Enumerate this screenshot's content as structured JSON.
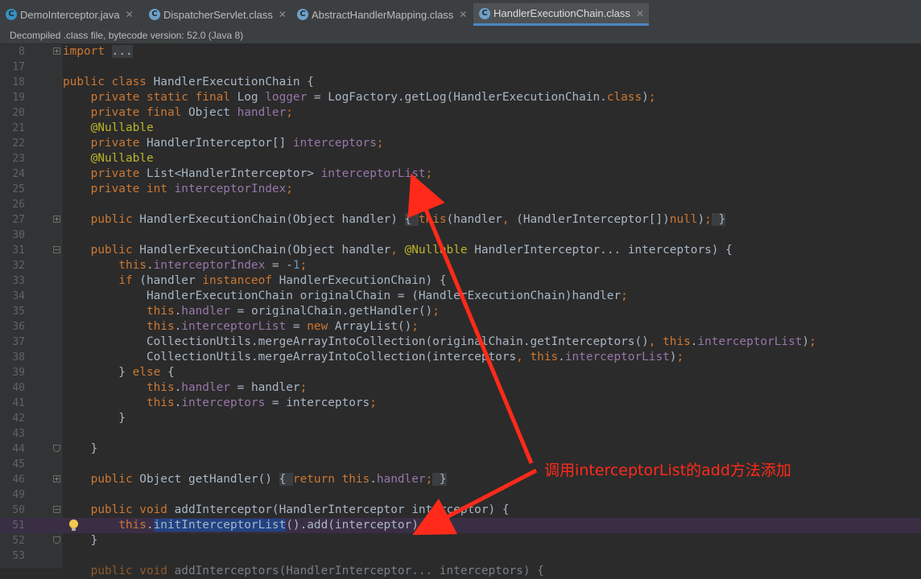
{
  "tabs": [
    {
      "label": "DemoInterceptor.java",
      "icon": "java-class-file-icon",
      "active": false
    },
    {
      "label": "DispatcherServlet.class",
      "icon": "class-file-icon",
      "active": false
    },
    {
      "label": "AbstractHandlerMapping.class",
      "icon": "class-file-icon",
      "active": false
    },
    {
      "label": "HandlerExecutionChain.class",
      "icon": "class-file-icon",
      "active": true
    }
  ],
  "banner": "Decompiled .class file, bytecode version: 52.0 (Java 8)",
  "line_numbers": [
    "8",
    "17",
    "18",
    "19",
    "20",
    "21",
    "22",
    "23",
    "24",
    "25",
    "26",
    "27",
    "30",
    "31",
    "32",
    "33",
    "34",
    "35",
    "36",
    "37",
    "38",
    "39",
    "40",
    "41",
    "42",
    "43",
    "44",
    "45",
    "46",
    "49",
    "50",
    "51",
    "52",
    "53"
  ],
  "current_line": "51",
  "annotation": "调用interceptorList的add方法添加",
  "colors": {
    "keyword": "#cc7832",
    "field": "#9876aa",
    "annotation": "#bbb529",
    "number": "#6897bb",
    "arrow": "#ff2a1a"
  }
}
